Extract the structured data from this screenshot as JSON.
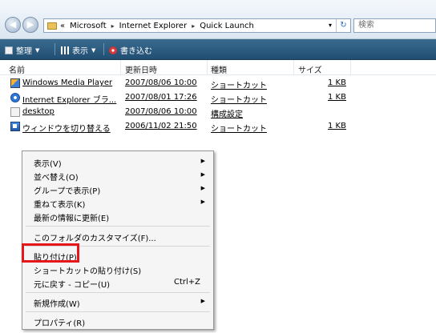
{
  "address": {
    "crumbs": [
      "«",
      "Microsoft",
      "Internet Explorer",
      "Quick Launch"
    ],
    "separator": "▸",
    "dropdown_glyph": "▾",
    "refresh_glyph": "↻",
    "search_placeholder": "検索"
  },
  "toolbar": {
    "organize": "整理",
    "views": "表示",
    "burn": "書き込む",
    "caret": "▼"
  },
  "columns": [
    "名前",
    "更新日時",
    "種類",
    "サイズ"
  ],
  "files": [
    {
      "name": "Windows Media Player",
      "date": "2007/08/06 10:00",
      "type": "ショートカット",
      "size": "1 KB",
      "icon": "media-player-icon"
    },
    {
      "name": "Internet Explorer ブラ...",
      "date": "2007/08/01 17:26",
      "type": "ショートカット",
      "size": "1 KB",
      "icon": "internet-explorer-icon"
    },
    {
      "name": "desktop",
      "date": "2007/08/06 10:00",
      "type": "構成設定",
      "size": "",
      "icon": "desktop-ini-icon"
    },
    {
      "name": "ウィンドウを切り替える",
      "date": "2006/11/02 21:50",
      "type": "ショートカット",
      "size": "1 KB",
      "icon": "switch-windows-icon"
    }
  ],
  "context_menu": {
    "arrow_glyph": "▶",
    "items": [
      {
        "label": "表示(V)",
        "submenu": true
      },
      {
        "label": "並べ替え(O)",
        "submenu": true
      },
      {
        "label": "グループで表示(P)",
        "submenu": true
      },
      {
        "label": "重ねて表示(K)",
        "submenu": true
      },
      {
        "label": "最新の情報に更新(E)"
      },
      {
        "label": "このフォルダのカスタマイズ(F)..."
      },
      {
        "label": "貼り付け(P)"
      },
      {
        "label": "ショートカットの貼り付け(S)"
      },
      {
        "label": "元に戻す - コピー(U)",
        "shortcut": "Ctrl+Z"
      },
      {
        "label": "新規作成(W)",
        "submenu": true
      },
      {
        "label": "プロパティ(R)"
      }
    ]
  },
  "highlight_color": "#e8151b"
}
